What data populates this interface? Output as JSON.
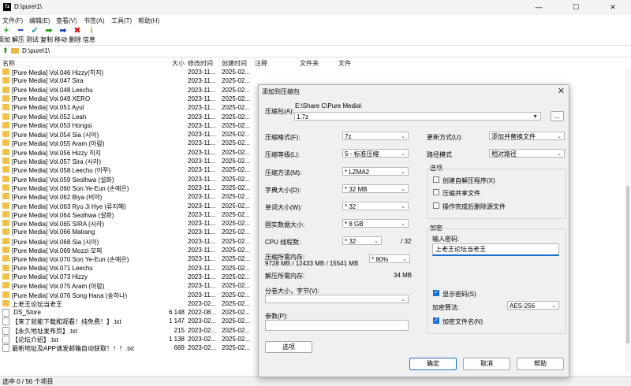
{
  "window": {
    "title": "D:\\pure\\1\\",
    "minimize": "—",
    "maximize": "☐",
    "close": "✕",
    "app_icon": "7z"
  },
  "menu": [
    "文件(F)",
    "编辑(E)",
    "查看(V)",
    "书签(A)",
    "工具(T)",
    "帮助(H)"
  ],
  "toolbar": [
    {
      "label": "添加",
      "icon": "+",
      "color": "#1a9a1a"
    },
    {
      "label": "解压",
      "icon": "━",
      "color": "#1a3fa8"
    },
    {
      "label": "测试",
      "icon": "✔",
      "color": "#1a9a9a"
    },
    {
      "label": "复制",
      "icon": "➡",
      "color": "#1a9a1a"
    },
    {
      "label": "移动",
      "icon": "➡",
      "color": "#1a3fa8"
    },
    {
      "label": "删除",
      "icon": "✖",
      "color": "#d01010"
    },
    {
      "label": "信息",
      "icon": "i",
      "color": "#c8a800"
    }
  ],
  "address": {
    "path": "D:\\pure\\1\\"
  },
  "columns": {
    "name": "名称",
    "size": "大小",
    "modified": "修改时间",
    "created": "创建时间",
    "comment": "注释",
    "folders": "文件夹",
    "files": "文件"
  },
  "rows": [
    {
      "type": "folder",
      "name": "[Pure Media] Vol.046 Hizzy(히지)",
      "size": "",
      "modified": "2023-11...",
      "created": "2025-02..."
    },
    {
      "type": "folder",
      "name": "[Pure Media] Vol.047 Sira",
      "size": "",
      "modified": "2023-11...",
      "created": "2025-02..."
    },
    {
      "type": "folder",
      "name": "[Pure Media] Vol.048 Leechu",
      "size": "",
      "modified": "2023-11...",
      "created": "2025-02..."
    },
    {
      "type": "folder",
      "name": "[Pure Media] Vol.049 XERO",
      "size": "",
      "modified": "2023-11...",
      "created": "2025-02..."
    },
    {
      "type": "folder",
      "name": "[Pure Media] Vol.051 Ayul",
      "size": "",
      "modified": "2023-11...",
      "created": "2025-02..."
    },
    {
      "type": "folder",
      "name": "[Pure Media] Vol.052 Leah",
      "size": "",
      "modified": "2023-11...",
      "created": "2025-02..."
    },
    {
      "type": "folder",
      "name": "[Pure Media] Vol.053 Hongsi",
      "size": "",
      "modified": "2023-11...",
      "created": "2025-02..."
    },
    {
      "type": "folder",
      "name": "[Pure Media] Vol.054 Sia (시아)",
      "size": "",
      "modified": "2023-11...",
      "created": "2025-02..."
    },
    {
      "type": "folder",
      "name": "[Pure Media] Vol.055 Aram (아람)",
      "size": "",
      "modified": "2023-11...",
      "created": "2025-02..."
    },
    {
      "type": "folder",
      "name": "[Pure Media] Vol.056 Hizzy 히지",
      "size": "",
      "modified": "2023-11...",
      "created": "2025-02..."
    },
    {
      "type": "folder",
      "name": "[Pure Media] Vol.057 Sira (시라)",
      "size": "",
      "modified": "2023-11...",
      "created": "2025-02..."
    },
    {
      "type": "folder",
      "name": "[Pure Media] Vol.058 Leechu (이쭈)",
      "size": "",
      "modified": "2023-11...",
      "created": "2025-02..."
    },
    {
      "type": "folder",
      "name": "[Pure Media] Vol.059 Seolhwa (설화)",
      "size": "",
      "modified": "2023-11...",
      "created": "2025-02..."
    },
    {
      "type": "folder",
      "name": "[Pure Media] Vol.060 Son Ye-Eun (손예은)",
      "size": "",
      "modified": "2023-11...",
      "created": "2025-02..."
    },
    {
      "type": "folder",
      "name": "[Pure Media] Vol.062 Biya (비야)",
      "size": "",
      "modified": "2023-11...",
      "created": "2025-02..."
    },
    {
      "type": "folder",
      "name": "[Pure Media] Vol.063 Ryu Ji Hye (류지혜)",
      "size": "",
      "modified": "2023-11...",
      "created": "2025-02..."
    },
    {
      "type": "folder",
      "name": "[Pure Media] Vol.064 Seolhwa (설화)",
      "size": "",
      "modified": "2023-11...",
      "created": "2025-02..."
    },
    {
      "type": "folder",
      "name": "[Pure Media] Vol.065 SIRA (시라)",
      "size": "",
      "modified": "2023-11...",
      "created": "2025-02..."
    },
    {
      "type": "folder",
      "name": "[Pure Media] Vol.066 Malrang",
      "size": "",
      "modified": "2023-11...",
      "created": "2025-02..."
    },
    {
      "type": "folder",
      "name": "[Pure Media] Vol.068 Sia (시아)",
      "size": "",
      "modified": "2023-11...",
      "created": "2025-02..."
    },
    {
      "type": "folder",
      "name": "[Pure Media] Vol.069 Mozzi 모찌",
      "size": "",
      "modified": "2023-11...",
      "created": "2025-02..."
    },
    {
      "type": "folder",
      "name": "[Pure Media] Vol.070 Son Ye-Eun (손예은)",
      "size": "",
      "modified": "2023-11...",
      "created": "2025-02..."
    },
    {
      "type": "folder",
      "name": "[Pure Media] Vol.071 Leechu",
      "size": "",
      "modified": "2023-11...",
      "created": "2025-02..."
    },
    {
      "type": "folder",
      "name": "[Pure Media] Vol.073 Hizzy",
      "size": "",
      "modified": "2023-11...",
      "created": "2025-02..."
    },
    {
      "type": "folder",
      "name": "[Pure Media] Vol.075 Aram (아람)",
      "size": "",
      "modified": "2023-11...",
      "created": "2025-02..."
    },
    {
      "type": "folder",
      "name": "[Pure Media] Vol.076 Song Hana (송하나)",
      "size": "",
      "modified": "2023-11...",
      "created": "2025-02..."
    },
    {
      "type": "folder",
      "name": "上老王论坛当老王",
      "size": "",
      "modified": "2023-02...",
      "created": "2025-02..."
    },
    {
      "type": "file",
      "name": ".DS_Store",
      "size": "6 148",
      "modified": "2022-08...",
      "created": "2025-02..."
    },
    {
      "type": "file",
      "name": "【来了就能下载和观看！纯免费！】.txt",
      "size": "1 147",
      "modified": "2023-02...",
      "created": "2025-02..."
    },
    {
      "type": "file",
      "name": "【永久地址发布页】.txt",
      "size": "215",
      "modified": "2023-02...",
      "created": "2025-02..."
    },
    {
      "type": "file",
      "name": "【论坛介绍】.txt",
      "size": "1 138",
      "modified": "2023-02...",
      "created": "2025-02..."
    },
    {
      "type": "file",
      "name": "最新地址及APP请发邮箱自动获取！！！.txt",
      "size": "669",
      "modified": "2023-02...",
      "created": "2025-02..."
    }
  ],
  "status": {
    "text": "选中 0 / 56 个项目"
  },
  "dialog": {
    "title": "添加到压缩包",
    "close": "✕",
    "archive_label": "压缩包(A):",
    "archive_path": "E:\\Share C\\Pure Media\\",
    "archive_name": "1.7z",
    "browse": "...",
    "format_label": "压缩格式(F):",
    "format_value": "7z",
    "level_label": "压缩等级(L):",
    "level_value": "5 - 标准压缩",
    "method_label": "压缩方法(M):",
    "method_value": "* LZMA2",
    "dict_label": "字典大小(D):",
    "dict_value": "* 32 MB",
    "word_label": "单词大小(W):",
    "word_value": "* 32",
    "solid_label": "固实数据大小:",
    "solid_value": "* 8 GB",
    "threads_label": "CPU 线程数:",
    "threads_value": "* 32",
    "threads_max": "/ 32",
    "mem_label": "压缩所需内存:",
    "mem_value": "9728 MB / 12433 MB / 15541 MB",
    "mem_pct": "* 80%",
    "decomp_label": "解压所需内存:",
    "decomp_value": "34 MB",
    "split_label": "分卷大小，字节(V):",
    "split_value": "",
    "params_label": "参数(P):",
    "params_value": "",
    "options_button": "选项",
    "update_label": "更新方式(U):",
    "update_value": "添加并替换文件",
    "pathmode_label": "路径模式",
    "pathmode_value": "相对路径",
    "options_group": "选项",
    "opt_sfx": "创建自解压程序(X)",
    "opt_shared": "压缩共享文件",
    "opt_delete": "操作完成后删除源文件",
    "encrypt_group": "加密",
    "password_label": "输入密码:",
    "password_value": "上老王论坛当老王",
    "show_password": "显示密码(S)",
    "method_enc_label": "加密算法:",
    "method_enc_value": "AES-256",
    "encrypt_names": "加密文件名(N)",
    "ok": "确定",
    "cancel": "取消",
    "help": "帮助"
  }
}
